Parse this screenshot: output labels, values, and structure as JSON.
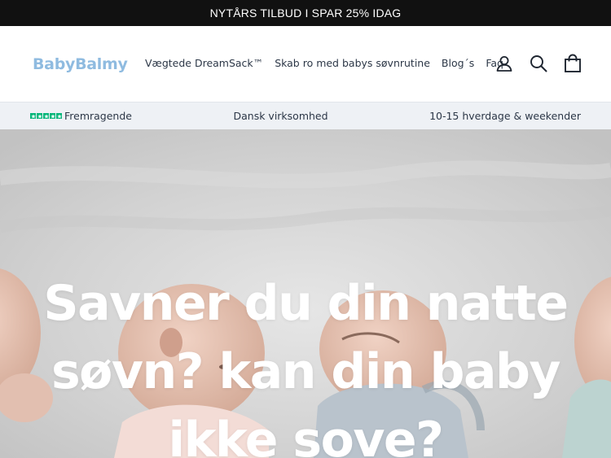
{
  "announcement": {
    "text": "NYTÅRS TILBUD I SPAR 25% IDAG"
  },
  "header": {
    "logo": "BabyBalmy",
    "nav": [
      {
        "label": "Vægtede DreamSack™"
      },
      {
        "label": "Skab ro med babys søvnrutine"
      },
      {
        "label": "Blog´s"
      },
      {
        "label": "Faq"
      }
    ],
    "icons": [
      "account-icon",
      "search-icon",
      "cart-icon"
    ]
  },
  "usp": {
    "rating_label": "Fremragende",
    "rating_stars": 5,
    "center": "Dansk virksomhed",
    "right": "10-15 hverdage & weekender"
  },
  "hero": {
    "title": "Savner du din natte søvn? kan din baby ikke sove?"
  },
  "colors": {
    "announce_bg": "#111111",
    "logo": "#8fbbe0",
    "usp_bg": "#eef1f5",
    "trustpilot_green": "#00b67a"
  }
}
